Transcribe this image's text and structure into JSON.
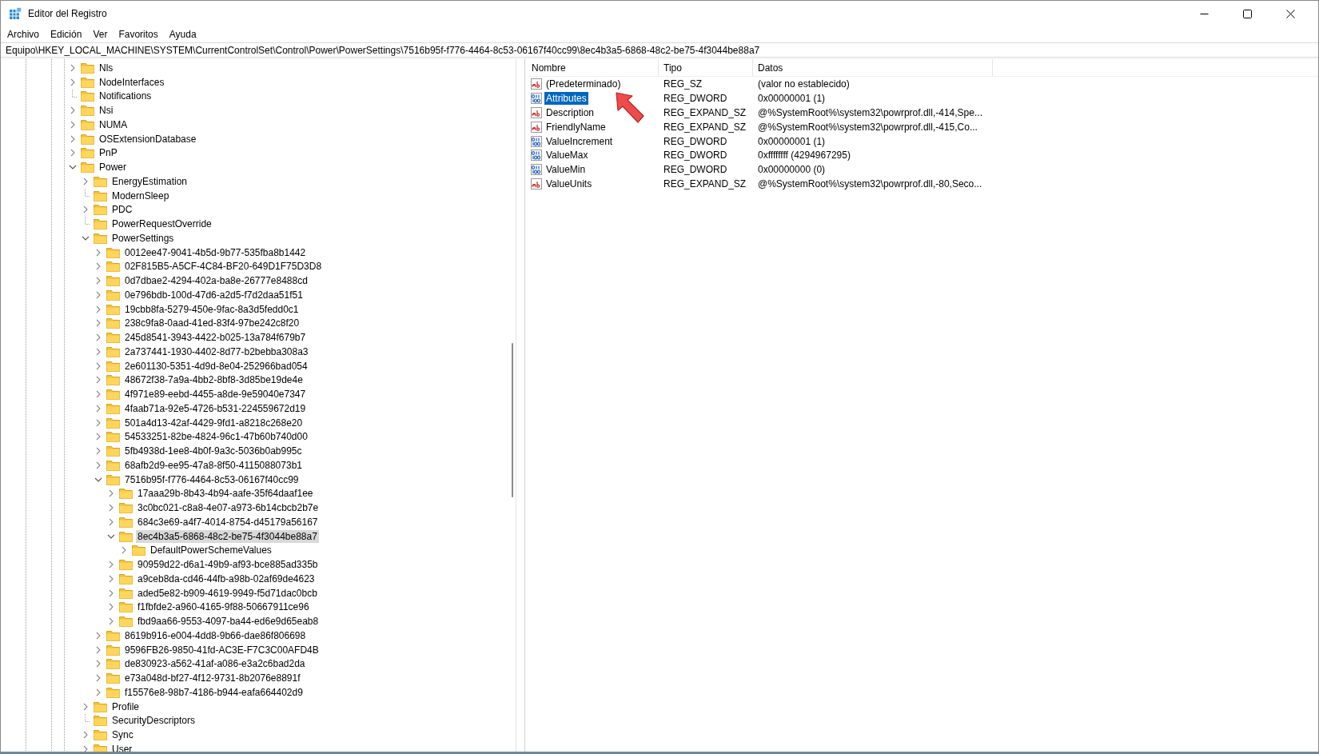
{
  "window": {
    "title": "Editor del Registro"
  },
  "menu": [
    "Archivo",
    "Edición",
    "Ver",
    "Favoritos",
    "Ayuda"
  ],
  "address": "Equipo\\HKEY_LOCAL_MACHINE\\SYSTEM\\CurrentControlSet\\Control\\Power\\PowerSettings\\7516b95f-f776-4464-8c53-06167f40cc99\\8ec4b3a5-6868-48c2-be75-4f3044be88a7",
  "tree": [
    {
      "label": "Nls",
      "expandable": true,
      "expanded": false,
      "selected": false
    },
    {
      "label": "NodeInterfaces",
      "expandable": true,
      "expanded": false,
      "selected": false
    },
    {
      "label": "Notifications",
      "expandable": false,
      "selected": false
    },
    {
      "label": "Nsi",
      "expandable": true,
      "expanded": false,
      "selected": false
    },
    {
      "label": "NUMA",
      "expandable": true,
      "expanded": false,
      "selected": false
    },
    {
      "label": "OSExtensionDatabase",
      "expandable": true,
      "expanded": false,
      "selected": false
    },
    {
      "label": "PnP",
      "expandable": true,
      "expanded": false,
      "selected": false
    },
    {
      "label": "Power",
      "expandable": true,
      "expanded": true,
      "selected": false,
      "children": [
        {
          "label": "EnergyEstimation",
          "expandable": true,
          "expanded": false,
          "selected": false
        },
        {
          "label": "ModernSleep",
          "expandable": false,
          "selected": false
        },
        {
          "label": "PDC",
          "expandable": true,
          "expanded": false,
          "selected": false
        },
        {
          "label": "PowerRequestOverride",
          "expandable": false,
          "selected": false
        },
        {
          "label": "PowerSettings",
          "expandable": true,
          "expanded": true,
          "selected": false,
          "children": [
            {
              "label": "0012ee47-9041-4b5d-9b77-535fba8b1442",
              "expandable": true,
              "expanded": false,
              "selected": false
            },
            {
              "label": "02F815B5-A5CF-4C84-BF20-649D1F75D3D8",
              "expandable": true,
              "expanded": false,
              "selected": false
            },
            {
              "label": "0d7dbae2-4294-402a-ba8e-26777e8488cd",
              "expandable": true,
              "expanded": false,
              "selected": false
            },
            {
              "label": "0e796bdb-100d-47d6-a2d5-f7d2daa51f51",
              "expandable": true,
              "expanded": false,
              "selected": false
            },
            {
              "label": "19cbb8fa-5279-450e-9fac-8a3d5fedd0c1",
              "expandable": true,
              "expanded": false,
              "selected": false
            },
            {
              "label": "238c9fa8-0aad-41ed-83f4-97be242c8f20",
              "expandable": true,
              "expanded": false,
              "selected": false
            },
            {
              "label": "245d8541-3943-4422-b025-13a784f679b7",
              "expandable": true,
              "expanded": false,
              "selected": false
            },
            {
              "label": "2a737441-1930-4402-8d77-b2bebba308a3",
              "expandable": true,
              "expanded": false,
              "selected": false
            },
            {
              "label": "2e601130-5351-4d9d-8e04-252966bad054",
              "expandable": true,
              "expanded": false,
              "selected": false
            },
            {
              "label": "48672f38-7a9a-4bb2-8bf8-3d85be19de4e",
              "expandable": true,
              "expanded": false,
              "selected": false
            },
            {
              "label": "4f971e89-eebd-4455-a8de-9e59040e7347",
              "expandable": true,
              "expanded": false,
              "selected": false
            },
            {
              "label": "4faab71a-92e5-4726-b531-224559672d19",
              "expandable": true,
              "expanded": false,
              "selected": false
            },
            {
              "label": "501a4d13-42af-4429-9fd1-a8218c268e20",
              "expandable": true,
              "expanded": false,
              "selected": false
            },
            {
              "label": "54533251-82be-4824-96c1-47b60b740d00",
              "expandable": true,
              "expanded": false,
              "selected": false
            },
            {
              "label": "5fb4938d-1ee8-4b0f-9a3c-5036b0ab995c",
              "expandable": true,
              "expanded": false,
              "selected": false
            },
            {
              "label": "68afb2d9-ee95-47a8-8f50-4115088073b1",
              "expandable": true,
              "expanded": false,
              "selected": false
            },
            {
              "label": "7516b95f-f776-4464-8c53-06167f40cc99",
              "expandable": true,
              "expanded": true,
              "selected": false,
              "children": [
                {
                  "label": "17aaa29b-8b43-4b94-aafe-35f64daaf1ee",
                  "expandable": true,
                  "expanded": false,
                  "selected": false
                },
                {
                  "label": "3c0bc021-c8a8-4e07-a973-6b14cbcb2b7e",
                  "expandable": true,
                  "expanded": false,
                  "selected": false
                },
                {
                  "label": "684c3e69-a4f7-4014-8754-d45179a56167",
                  "expandable": true,
                  "expanded": false,
                  "selected": false
                },
                {
                  "label": "8ec4b3a5-6868-48c2-be75-4f3044be88a7",
                  "expandable": true,
                  "expanded": true,
                  "selected": true,
                  "children": [
                    {
                      "label": "DefaultPowerSchemeValues",
                      "expandable": true,
                      "expanded": false,
                      "selected": false
                    }
                  ]
                },
                {
                  "label": "90959d22-d6a1-49b9-af93-bce885ad335b",
                  "expandable": true,
                  "expanded": false,
                  "selected": false
                },
                {
                  "label": "a9ceb8da-cd46-44fb-a98b-02af69de4623",
                  "expandable": true,
                  "expanded": false,
                  "selected": false
                },
                {
                  "label": "aded5e82-b909-4619-9949-f5d71dac0bcb",
                  "expandable": true,
                  "expanded": false,
                  "selected": false
                },
                {
                  "label": "f1fbfde2-a960-4165-9f88-50667911ce96",
                  "expandable": true,
                  "expanded": false,
                  "selected": false
                },
                {
                  "label": "fbd9aa66-9553-4097-ba44-ed6e9d65eab8",
                  "expandable": true,
                  "expanded": false,
                  "selected": false
                }
              ]
            },
            {
              "label": "8619b916-e004-4dd8-9b66-dae86f806698",
              "expandable": true,
              "expanded": false,
              "selected": false
            },
            {
              "label": "9596FB26-9850-41fd-AC3E-F7C3C00AFD4B",
              "expandable": true,
              "expanded": false,
              "selected": false
            },
            {
              "label": "de830923-a562-41af-a086-e3a2c6bad2da",
              "expandable": true,
              "expanded": false,
              "selected": false
            },
            {
              "label": "e73a048d-bf27-4f12-9731-8b2076e8891f",
              "expandable": true,
              "expanded": false,
              "selected": false
            },
            {
              "label": "f15576e8-98b7-4186-b944-eafa664402d9",
              "expandable": true,
              "expanded": false,
              "selected": false
            }
          ]
        },
        {
          "label": "Profile",
          "expandable": true,
          "expanded": false,
          "selected": false
        },
        {
          "label": "SecurityDescriptors",
          "expandable": false,
          "selected": false
        },
        {
          "label": "Sync",
          "expandable": true,
          "expanded": false,
          "selected": false
        },
        {
          "label": "User",
          "expandable": true,
          "expanded": false,
          "selected": false
        }
      ]
    }
  ],
  "table": {
    "columns": [
      "Nombre",
      "Tipo",
      "Datos"
    ],
    "rows": [
      {
        "kind": "string",
        "name": "(Predeterminado)",
        "type": "REG_SZ",
        "data": "(valor no establecido)",
        "selected": false
      },
      {
        "kind": "binary",
        "name": "Attributes",
        "type": "REG_DWORD",
        "data": "0x00000001 (1)",
        "selected": true
      },
      {
        "kind": "string",
        "name": "Description",
        "type": "REG_EXPAND_SZ",
        "data": "@%SystemRoot%\\system32\\powrprof.dll,-414,Spe...",
        "selected": false
      },
      {
        "kind": "string",
        "name": "FriendlyName",
        "type": "REG_EXPAND_SZ",
        "data": "@%SystemRoot%\\system32\\powrprof.dll,-415,Co...",
        "selected": false
      },
      {
        "kind": "binary",
        "name": "ValueIncrement",
        "type": "REG_DWORD",
        "data": "0x00000001 (1)",
        "selected": false
      },
      {
        "kind": "binary",
        "name": "ValueMax",
        "type": "REG_DWORD",
        "data": "0xffffffff (4294967295)",
        "selected": false
      },
      {
        "kind": "binary",
        "name": "ValueMin",
        "type": "REG_DWORD",
        "data": "0x00000000 (0)",
        "selected": false
      },
      {
        "kind": "string",
        "name": "ValueUnits",
        "type": "REG_EXPAND_SZ",
        "data": "@%SystemRoot%\\system32\\powrprof.dll,-80,Seco...",
        "selected": false
      }
    ]
  }
}
